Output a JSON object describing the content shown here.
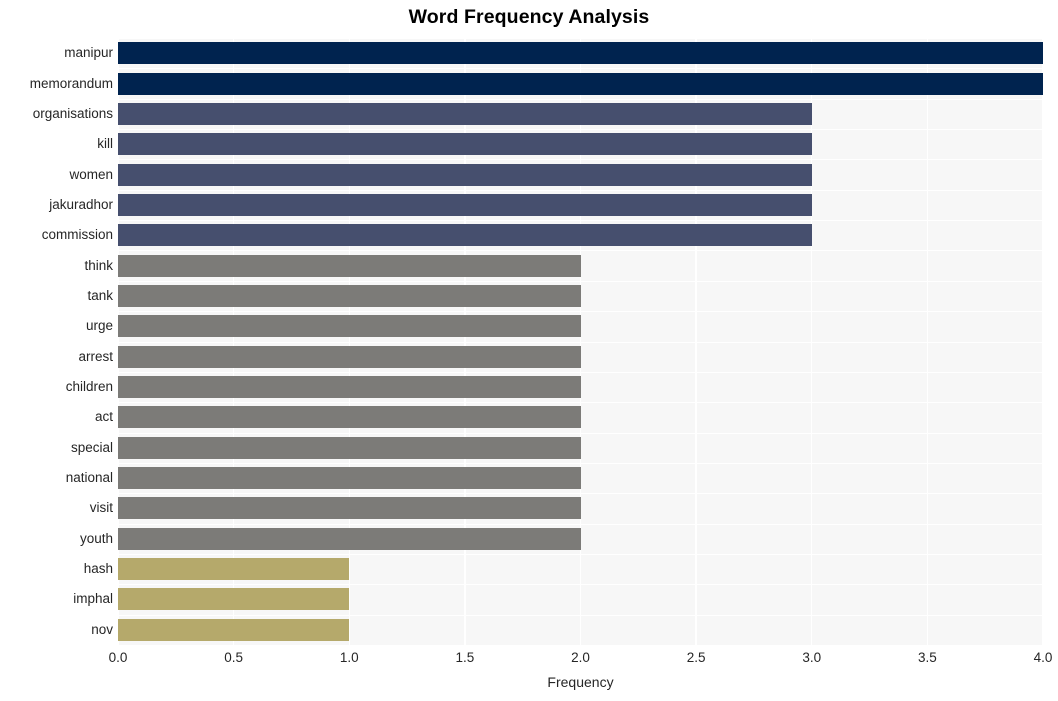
{
  "chart_data": {
    "type": "bar",
    "orientation": "horizontal",
    "title": "Word Frequency Analysis",
    "xlabel": "Frequency",
    "ylabel": "",
    "xlim": [
      0.0,
      4.0
    ],
    "xticks": [
      "0.0",
      "0.5",
      "1.0",
      "1.5",
      "2.0",
      "2.5",
      "3.0",
      "3.5",
      "4.0"
    ],
    "xtick_values": [
      0.0,
      0.5,
      1.0,
      1.5,
      2.0,
      2.5,
      3.0,
      3.5,
      4.0
    ],
    "grid": true,
    "legend": "none",
    "categories": [
      "manipur",
      "memorandum",
      "organisations",
      "kill",
      "women",
      "jakuradhor",
      "commission",
      "think",
      "tank",
      "urge",
      "arrest",
      "children",
      "act",
      "special",
      "national",
      "visit",
      "youth",
      "hash",
      "imphal",
      "nov"
    ],
    "values": [
      4,
      4,
      3,
      3,
      3,
      3,
      3,
      2,
      2,
      2,
      2,
      2,
      2,
      2,
      2,
      2,
      2,
      1,
      1,
      1
    ],
    "bar_colors": [
      "#00234f",
      "#00234f",
      "#464f6e",
      "#464f6e",
      "#464f6e",
      "#464f6e",
      "#464f6e",
      "#7c7b78",
      "#7c7b78",
      "#7c7b78",
      "#7c7b78",
      "#7c7b78",
      "#7c7b78",
      "#7c7b78",
      "#7c7b78",
      "#7c7b78",
      "#7c7b78",
      "#b5a96b",
      "#b5a96b",
      "#b5a96b"
    ]
  },
  "style": {
    "plot_background": "#f7f7f7",
    "grid_color": "#ffffff",
    "figure_background": "#ffffff",
    "text_color": "#262626",
    "title_color": "#000000"
  }
}
